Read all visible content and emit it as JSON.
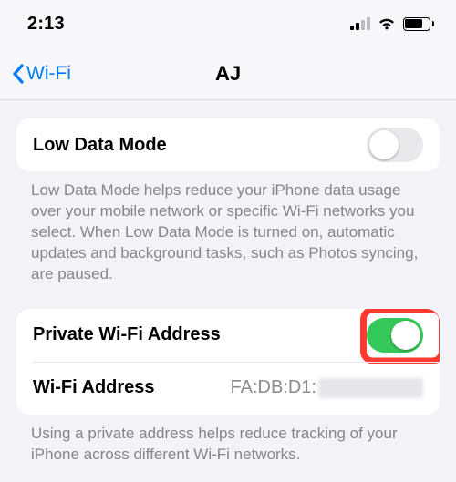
{
  "status": {
    "time": "2:13"
  },
  "nav": {
    "back_label": "Wi-Fi",
    "title": "AJ"
  },
  "low_data": {
    "label": "Low Data Mode",
    "footer": "Low Data Mode helps reduce your iPhone data usage over your mobile network or specific Wi-Fi networks you select. When Low Data Mode is turned on, automatic updates and background tasks, such as Photos syncing, are paused."
  },
  "private_wifi": {
    "label": "Private Wi-Fi Address",
    "address_label": "Wi-Fi Address",
    "address_value": "FA:DB:D1:",
    "footer": "Using a private address helps reduce tracking of your iPhone across different Wi-Fi networks."
  }
}
